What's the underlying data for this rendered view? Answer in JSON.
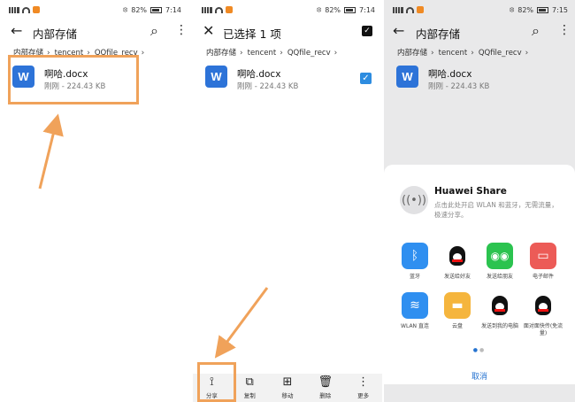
{
  "status": {
    "battery": "82%",
    "time1": "7:14",
    "time2": "7:14",
    "time3": "7:15"
  },
  "screen1": {
    "title": "内部存储",
    "breadcrumbs": [
      "内部存储",
      "tencent",
      "QQfile_recv"
    ],
    "file": {
      "name": "啊哈.docx",
      "meta": "刚刚 - 224.43 KB",
      "icon_letter": "W"
    }
  },
  "screen2": {
    "title": "已选择 1 项",
    "breadcrumbs": [
      "内部存储",
      "tencent",
      "QQfile_recv"
    ],
    "file": {
      "name": "啊哈.docx",
      "meta": "刚刚 - 224.43 KB",
      "icon_letter": "W"
    },
    "bottom_actions": [
      {
        "label": "分享",
        "icon": "share-icon"
      },
      {
        "label": "复制",
        "icon": "copy-icon"
      },
      {
        "label": "移动",
        "icon": "move-icon"
      },
      {
        "label": "删除",
        "icon": "delete-icon"
      },
      {
        "label": "更多",
        "icon": "more-icon"
      }
    ]
  },
  "screen3": {
    "title": "内部存储",
    "breadcrumbs": [
      "内部存储",
      "tencent",
      "QQfile_recv"
    ],
    "file": {
      "name": "啊哈.docx",
      "meta": "刚刚 - 224.43 KB",
      "icon_letter": "W"
    },
    "share_sheet": {
      "huawei_title": "Huawei Share",
      "huawei_desc": "点击此处开启 WLAN 和蓝牙，无需流量，极速分享。",
      "apps": [
        {
          "label": "蓝牙",
          "icon": "bluetooth-icon",
          "color": "#2f8ff0"
        },
        {
          "label": "发送给好友",
          "icon": "qq-icon",
          "color": "#ffffff"
        },
        {
          "label": "发送给朋友",
          "icon": "wechat-icon",
          "color": "#2bc34f"
        },
        {
          "label": "电子邮件",
          "icon": "email-icon",
          "color": "#ec5b57"
        },
        {
          "label": "WLAN 直连",
          "icon": "wifi-direct-icon",
          "color": "#2f8ff0"
        },
        {
          "label": "云盘",
          "icon": "folder-icon",
          "color": "#f5b53d"
        },
        {
          "label": "发送到我的电脑",
          "icon": "qq-icon",
          "color": "#ffffff"
        },
        {
          "label": "面对面快传(免流量)",
          "icon": "qq-icon",
          "color": "#ffffff"
        }
      ],
      "cancel_label": "取消"
    }
  },
  "colors": {
    "highlight": "#f0a25a",
    "accent": "#2d73d8",
    "checkbox": "#2d8ce0"
  }
}
